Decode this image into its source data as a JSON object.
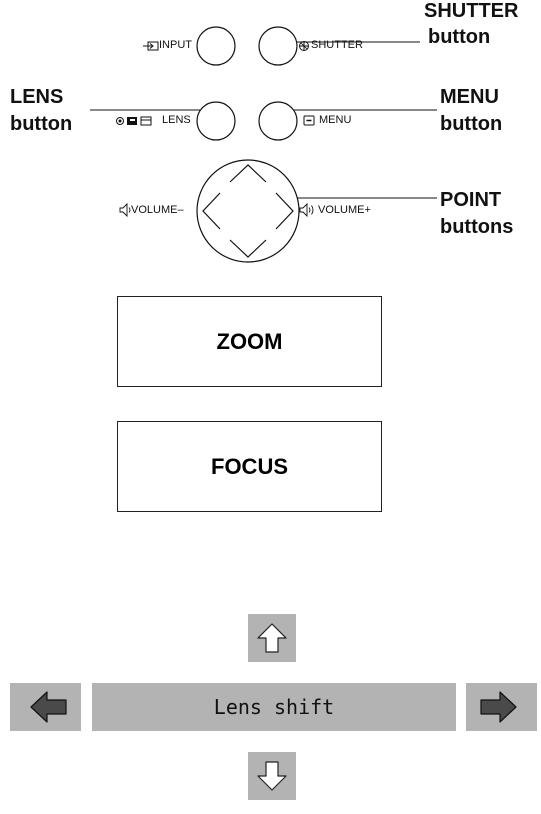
{
  "buttons": {
    "input_label": "INPUT",
    "shutter_label": "SHUTTER",
    "lens_label": "LENS",
    "menu_label": "MENU",
    "volume_minus_label": "VOLUME–",
    "volume_plus_label": "VOLUME+"
  },
  "callouts": {
    "shutter_line1": "SHUTTER",
    "shutter_line2": "button",
    "lens_line1": "LENS",
    "lens_line2": "button",
    "menu_line1": "MENU",
    "menu_line2": "button",
    "point_line1": "POINT",
    "point_line2": "buttons"
  },
  "panels": {
    "zoom_label": "ZOOM",
    "focus_label": "FOCUS"
  },
  "lens_shift": {
    "label": "Lens shift"
  },
  "icons": [
    "input-icon",
    "shutter-icon",
    "lens-icons",
    "menu-icon",
    "volume-down-icon",
    "volume-up-icon",
    "arrow-up-icon",
    "arrow-down-icon",
    "arrow-left-icon",
    "arrow-right-icon"
  ]
}
